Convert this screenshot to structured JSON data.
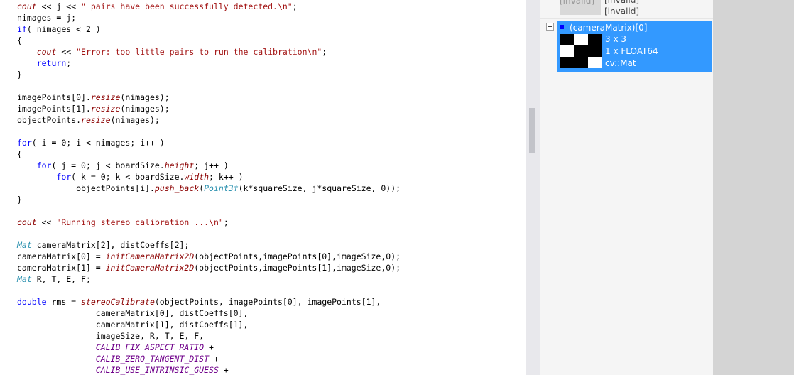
{
  "code": {
    "lines": [
      [
        {
          "t": "cout",
          "c": "fn"
        },
        {
          "t": " << j << ",
          "c": "nm"
        },
        {
          "t": "\" pairs have been successfully detected.\\n\"",
          "c": "st"
        },
        {
          "t": ";",
          "c": "nm"
        }
      ],
      [
        {
          "t": "nimages = j;",
          "c": "nm"
        }
      ],
      [
        {
          "t": "if",
          "c": "kw"
        },
        {
          "t": "( nimages < 2 )",
          "c": "nm"
        }
      ],
      [
        {
          "t": "{",
          "c": "nm"
        }
      ],
      [
        {
          "t": "    ",
          "c": "nm"
        },
        {
          "t": "cout",
          "c": "fn"
        },
        {
          "t": " << ",
          "c": "nm"
        },
        {
          "t": "\"Error: too little pairs to run the calibration\\n\"",
          "c": "st"
        },
        {
          "t": ";",
          "c": "nm"
        }
      ],
      [
        {
          "t": "    ",
          "c": "nm"
        },
        {
          "t": "return",
          "c": "kw"
        },
        {
          "t": ";",
          "c": "nm"
        }
      ],
      [
        {
          "t": "}",
          "c": "nm"
        }
      ],
      [],
      [
        {
          "t": "imagePoints[0].",
          "c": "nm"
        },
        {
          "t": "resize",
          "c": "fn"
        },
        {
          "t": "(nimages);",
          "c": "nm"
        }
      ],
      [
        {
          "t": "imagePoints[1].",
          "c": "nm"
        },
        {
          "t": "resize",
          "c": "fn"
        },
        {
          "t": "(nimages);",
          "c": "nm"
        }
      ],
      [
        {
          "t": "objectPoints.",
          "c": "nm"
        },
        {
          "t": "resize",
          "c": "fn"
        },
        {
          "t": "(nimages);",
          "c": "nm"
        }
      ],
      [],
      [
        {
          "t": "for",
          "c": "kw"
        },
        {
          "t": "( i = 0; i < nimages; i++ )",
          "c": "nm"
        }
      ],
      [
        {
          "t": "{",
          "c": "nm"
        }
      ],
      [
        {
          "t": "    ",
          "c": "nm"
        },
        {
          "t": "for",
          "c": "kw"
        },
        {
          "t": "( j = 0; j < boardSize.",
          "c": "nm"
        },
        {
          "t": "height",
          "c": "fn"
        },
        {
          "t": "; j++ )",
          "c": "nm"
        }
      ],
      [
        {
          "t": "        ",
          "c": "nm"
        },
        {
          "t": "for",
          "c": "kw"
        },
        {
          "t": "( k = 0; k < boardSize.",
          "c": "nm"
        },
        {
          "t": "width",
          "c": "fn"
        },
        {
          "t": "; k++ )",
          "c": "nm"
        }
      ],
      [
        {
          "t": "            objectPoints[i].",
          "c": "nm"
        },
        {
          "t": "push_back",
          "c": "fn"
        },
        {
          "t": "(",
          "c": "nm"
        },
        {
          "t": "Point3f",
          "c": "id"
        },
        {
          "t": "(k*squareSize, j*squareSize, 0));",
          "c": "nm"
        }
      ],
      [
        {
          "t": "}",
          "c": "nm"
        }
      ],
      [],
      [
        {
          "t": "cout",
          "c": "fn"
        },
        {
          "t": " << ",
          "c": "nm"
        },
        {
          "t": "\"Running stereo calibration ...\\n\"",
          "c": "st"
        },
        {
          "t": ";",
          "c": "nm"
        }
      ],
      [],
      [
        {
          "t": "Mat",
          "c": "id"
        },
        {
          "t": " cameraMatrix[2], distCoeffs[2];",
          "c": "nm"
        }
      ],
      [
        {
          "t": "cameraMatrix[0] = ",
          "c": "nm"
        },
        {
          "t": "initCameraMatrix2D",
          "c": "fn"
        },
        {
          "t": "(objectPoints,imagePoints[0],imageSize,0);",
          "c": "nm"
        }
      ],
      [
        {
          "t": "cameraMatrix[1] = ",
          "c": "nm"
        },
        {
          "t": "initCameraMatrix2D",
          "c": "fn"
        },
        {
          "t": "(objectPoints,imagePoints[1],imageSize,0);",
          "c": "nm"
        }
      ],
      [
        {
          "t": "Mat",
          "c": "id"
        },
        {
          "t": " R, T, E, F;",
          "c": "nm"
        }
      ],
      [],
      [
        {
          "t": "double",
          "c": "kw"
        },
        {
          "t": " rms = ",
          "c": "nm"
        },
        {
          "t": "stereoCalibrate",
          "c": "fn"
        },
        {
          "t": "(objectPoints, imagePoints[0], imagePoints[1],",
          "c": "nm"
        }
      ],
      [
        {
          "t": "                cameraMatrix[0], distCoeffs[0],",
          "c": "nm"
        }
      ],
      [
        {
          "t": "                cameraMatrix[1], distCoeffs[1],",
          "c": "nm"
        }
      ],
      [
        {
          "t": "                imageSize, R, T, E, F,",
          "c": "nm"
        }
      ],
      [
        {
          "t": "                ",
          "c": "nm"
        },
        {
          "t": "CALIB_FIX_ASPECT_RATIO",
          "c": "mc"
        },
        {
          "t": " +",
          "c": "nm"
        }
      ],
      [
        {
          "t": "                ",
          "c": "nm"
        },
        {
          "t": "CALIB_ZERO_TANGENT_DIST",
          "c": "mc"
        },
        {
          "t": " +",
          "c": "nm"
        }
      ],
      [
        {
          "t": "                ",
          "c": "nm"
        },
        {
          "t": "CALIB_USE_INTRINSIC_GUESS",
          "c": "mc"
        },
        {
          "t": " +",
          "c": "nm"
        }
      ]
    ]
  },
  "watch": {
    "prev_values": [
      "[invalid]",
      "[invalid]",
      "[invalid]"
    ],
    "selected": {
      "name": "(cameraMatrix)[0]",
      "size": "3 x 3",
      "type": "1 x FLOAT64",
      "class": "cv::Mat",
      "preview": [
        [
          "#000000",
          "#ffffff",
          "#000000"
        ],
        [
          "#ffffff",
          "#000000",
          "#000000"
        ],
        [
          "#000000",
          "#000000",
          "#ffffff"
        ]
      ]
    }
  },
  "colors": {
    "selection": "#3399ff",
    "keyword": "#0000ff",
    "function": "#8b0000",
    "string": "#a31515",
    "macro": "#6f008a",
    "type": "#2b91af"
  }
}
